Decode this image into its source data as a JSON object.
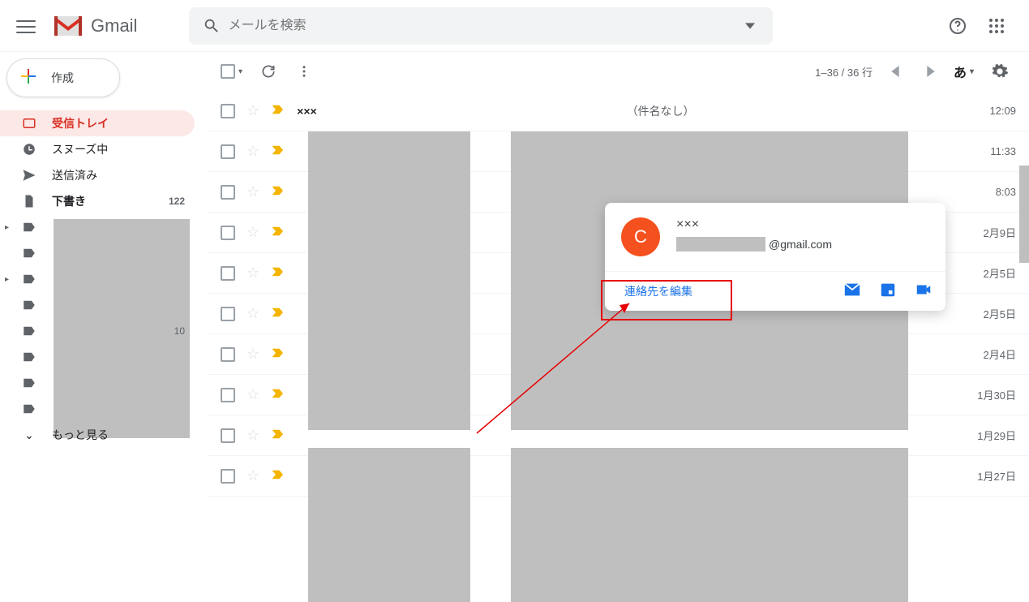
{
  "header": {
    "app_name": "Gmail",
    "search_placeholder": "メールを検索"
  },
  "compose": {
    "label": "作成"
  },
  "sidebar": {
    "items": [
      {
        "label": "受信トレイ",
        "icon": "inbox",
        "active": true
      },
      {
        "label": "スヌーズ中",
        "icon": "clock"
      },
      {
        "label": "送信済み",
        "icon": "send"
      },
      {
        "label": "下書き",
        "icon": "file",
        "count": "122"
      }
    ],
    "label_group_count": "10",
    "more_label": "もっと見る"
  },
  "toolbar": {
    "range": "1–36 / 36 行",
    "ime": "あ"
  },
  "contact_card": {
    "avatar_letter": "C",
    "name": "×××",
    "email_suffix": "@gmail.com",
    "edit_label": "連絡先を編集"
  },
  "mail_rows": [
    {
      "sender": "×××",
      "subject": "（件名なし）",
      "time": "12:09"
    },
    {
      "sender": "",
      "subject": "",
      "time": "11:33"
    },
    {
      "sender": "",
      "subject": "",
      "time": "8:03"
    },
    {
      "sender": "",
      "subject": "",
      "time": "2月9日"
    },
    {
      "sender": "",
      "subject": "",
      "time": "2月5日"
    },
    {
      "sender": "",
      "subject": "",
      "time": "2月5日"
    },
    {
      "sender": "",
      "subject": "",
      "time": "2月4日"
    },
    {
      "sender": "",
      "subject": "",
      "time": "1月30日"
    },
    {
      "sender": "",
      "subject": "",
      "time": "1月29日"
    },
    {
      "sender": "",
      "subject": "",
      "time": "1月27日"
    }
  ]
}
